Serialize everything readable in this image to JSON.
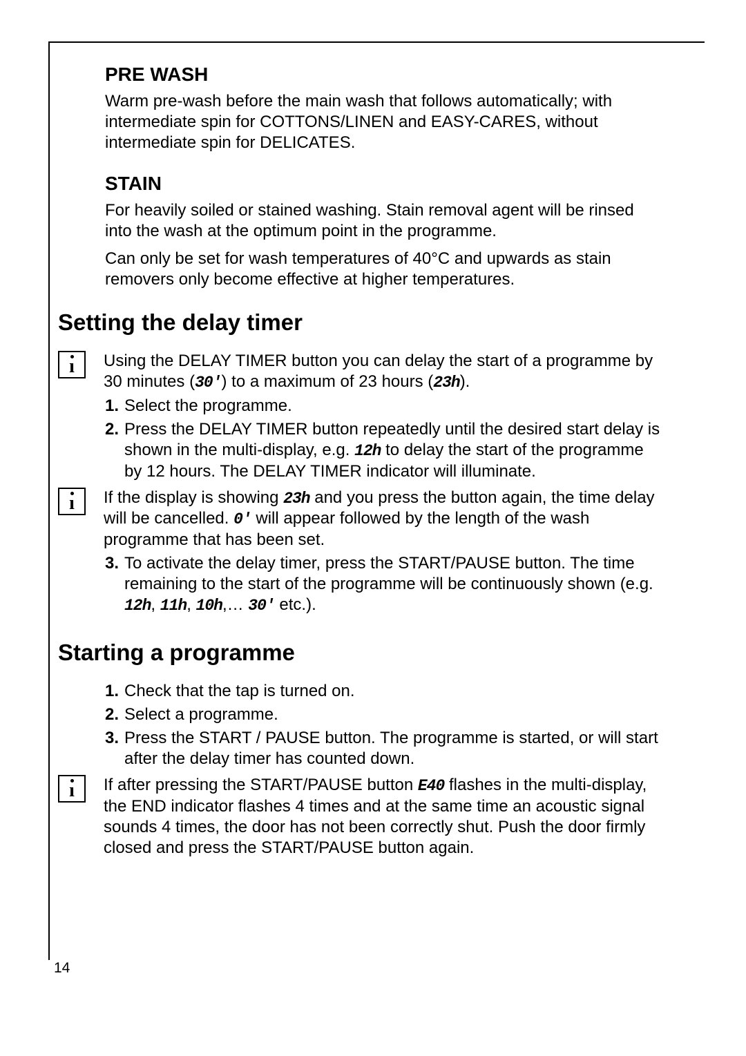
{
  "page_number": "14",
  "sections": {
    "pre_wash": {
      "heading": "PRE WASH",
      "body": "Warm pre-wash before the main wash that follows automatically; with intermediate spin for COTTONS/LINEN and EASY-CARES, without intermediate spin for DELICATES."
    },
    "stain": {
      "heading": "STAIN",
      "body1": "For heavily soiled or stained washing. Stain removal agent will be rinsed into the wash at the optimum point in the programme.",
      "body2": "Can only be set for wash temperatures of 40°C and upwards as stain removers only become effective at higher temperatures."
    },
    "delay_timer": {
      "heading": "Setting the delay timer",
      "info1_a": "Using the DELAY TIMER button you can delay the start of a programme by 30 minutes (",
      "seg_30m": "30'",
      "info1_b": ") to a maximum of 23 hours (",
      "seg_23h": "23h",
      "info1_c": ").",
      "step1": "Select the programme.",
      "step2_a": "Press the DELAY TIMER button repeatedly until the desired start delay is shown in the multi-display, e.g. ",
      "seg_12h": "12h",
      "step2_b": " to delay the start of the programme by 12 hours. The DELAY TIMER indicator will illuminate.",
      "info2_a": "If the display is showing ",
      "seg_23h_b": "23h",
      "info2_b": " and you press the button again, the time delay will be cancelled. ",
      "seg_0m": "0'",
      "info2_c": " will appear followed by the length of the wash programme that has been set.",
      "step3_a": "To activate the delay timer, press the START/PAUSE button. The time remaining to the start of the programme will be continuously shown (e.g. ",
      "seg_list_12h": "12h",
      "sep1": ", ",
      "seg_list_11h": "11h",
      "sep2": ", ",
      "seg_list_10h": "10h",
      "sep3": ",… ",
      "seg_list_30m": "30'",
      "step3_b": " etc.)."
    },
    "starting": {
      "heading": "Starting a programme",
      "step1": "Check that the tap is turned on.",
      "step2": "Select a programme.",
      "step3": "Press the START / PAUSE button. The programme is started, or will start after the delay timer has counted down.",
      "info_a": "If after pressing the START/PAUSE button ",
      "seg_e40": "E40",
      "info_b": " flashes in the multi-display, the END indicator flashes 4 times and at the same time an acoustic signal sounds 4 times, the door has not been correctly shut. Push the door firmly closed and press the START/PAUSE button again."
    }
  }
}
